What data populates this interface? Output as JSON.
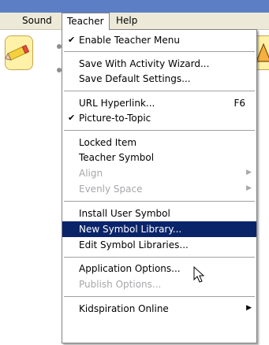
{
  "menubar": {
    "sound": "Sound",
    "teacher": "Teacher",
    "help": "Help"
  },
  "menu": {
    "items": [
      {
        "label": "Enable Teacher Menu",
        "checked": true
      },
      {
        "label": "Save With Activity Wizard..."
      },
      {
        "label": "Save Default Settings..."
      },
      {
        "label": "URL Hyperlink...",
        "shortcut": "F6"
      },
      {
        "label": "Picture-to-Topic",
        "checked": true
      },
      {
        "label": "Locked Item"
      },
      {
        "label": "Teacher Symbol"
      },
      {
        "label": "Align",
        "disabled": true,
        "submenu": true
      },
      {
        "label": "Evenly Space",
        "disabled": true,
        "submenu": true
      },
      {
        "label": "Install User Symbol"
      },
      {
        "label": "New Symbol Library...",
        "highlighted": true
      },
      {
        "label": "Edit Symbol Libraries..."
      },
      {
        "label": "Application Options..."
      },
      {
        "label": "Publish Options...",
        "disabled": true
      },
      {
        "label": "Kidspiration Online",
        "submenu": true
      }
    ],
    "check_glyph": "✔",
    "arrow_glyph": "▶"
  },
  "icons": {
    "toolbar_left": "pencil-icon",
    "toolbar_right": "triangle-icon",
    "cursor": "mouse-pointer-icon"
  },
  "colors": {
    "highlight": "#0a246a",
    "menubar": "#ece9d8",
    "title_strip": "#5b7ec4",
    "disabled_text": "#a7a6aa"
  }
}
